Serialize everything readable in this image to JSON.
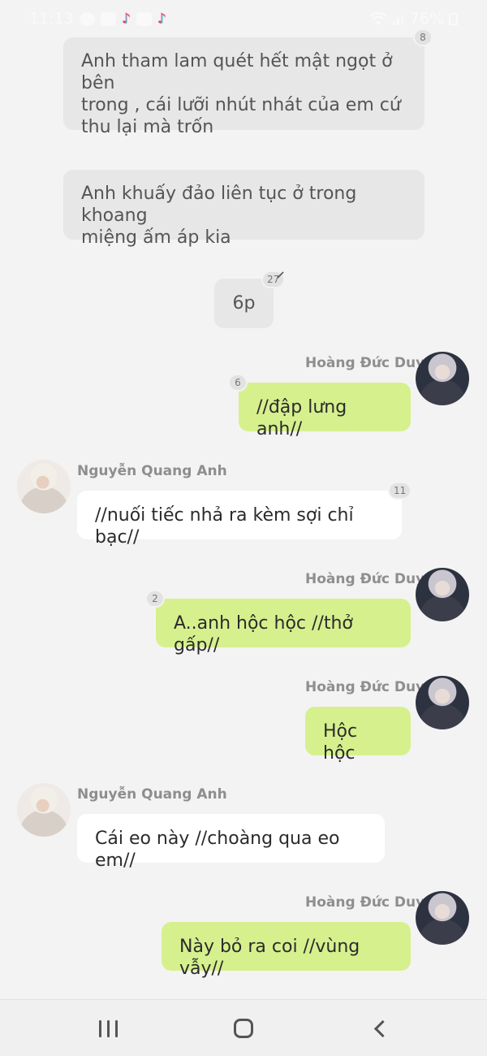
{
  "status_bar": {
    "time": "11:13",
    "battery": "76%",
    "left_icons": [
      "messenger-icon",
      "mail-icon",
      "tiktok-icon",
      "messenger-icon",
      "tiktok-icon"
    ],
    "right_icons": [
      "wifi-icon",
      "signal-icon",
      "battery-icon"
    ]
  },
  "messages": [
    {
      "type": "system",
      "text_lines": [
        "Anh tham lam quét hết mật ngọt ở bên",
        "trong , cái lưỡi nhút nhát của em cứ",
        "thu lại mà trốn"
      ],
      "count": "8"
    },
    {
      "type": "system",
      "text_lines": [
        "Anh khuấy đảo liên tục ở trong khoang",
        "miệng ấm áp kia"
      ]
    },
    {
      "type": "system",
      "text": "6p",
      "count": "27"
    },
    {
      "type": "out",
      "sender": "Hoàng Đức Duy",
      "text": "//đập lưng anh//",
      "count": "6"
    },
    {
      "type": "in",
      "sender": "Nguyễn Quang Anh",
      "text": "//nuối tiếc nhả ra kèm sợi chỉ bạc//",
      "count": "11"
    },
    {
      "type": "out",
      "sender": "Hoàng Đức Duy",
      "text": "A..anh hộc hộc //thở gấp//",
      "count": "2"
    },
    {
      "type": "out",
      "sender": "Hoàng Đức Duy",
      "text": "Hộc hộc"
    },
    {
      "type": "in",
      "sender": "Nguyễn Quang Anh",
      "text": "Cái eo này //choàng qua eo em//"
    },
    {
      "type": "out",
      "sender": "Hoàng Đức Duy",
      "text": "Này bỏ ra coi //vùng vẫy//"
    }
  ],
  "colors": {
    "background": "#f3f3f3",
    "system_bubble": "#e7e7e7",
    "incoming_bubble": "#ffffff",
    "outgoing_bubble": "#d6f08e",
    "sender_name": "#8e8e8e"
  },
  "nav_bar": {
    "buttons": [
      "recents-button",
      "home-button",
      "back-button"
    ]
  }
}
